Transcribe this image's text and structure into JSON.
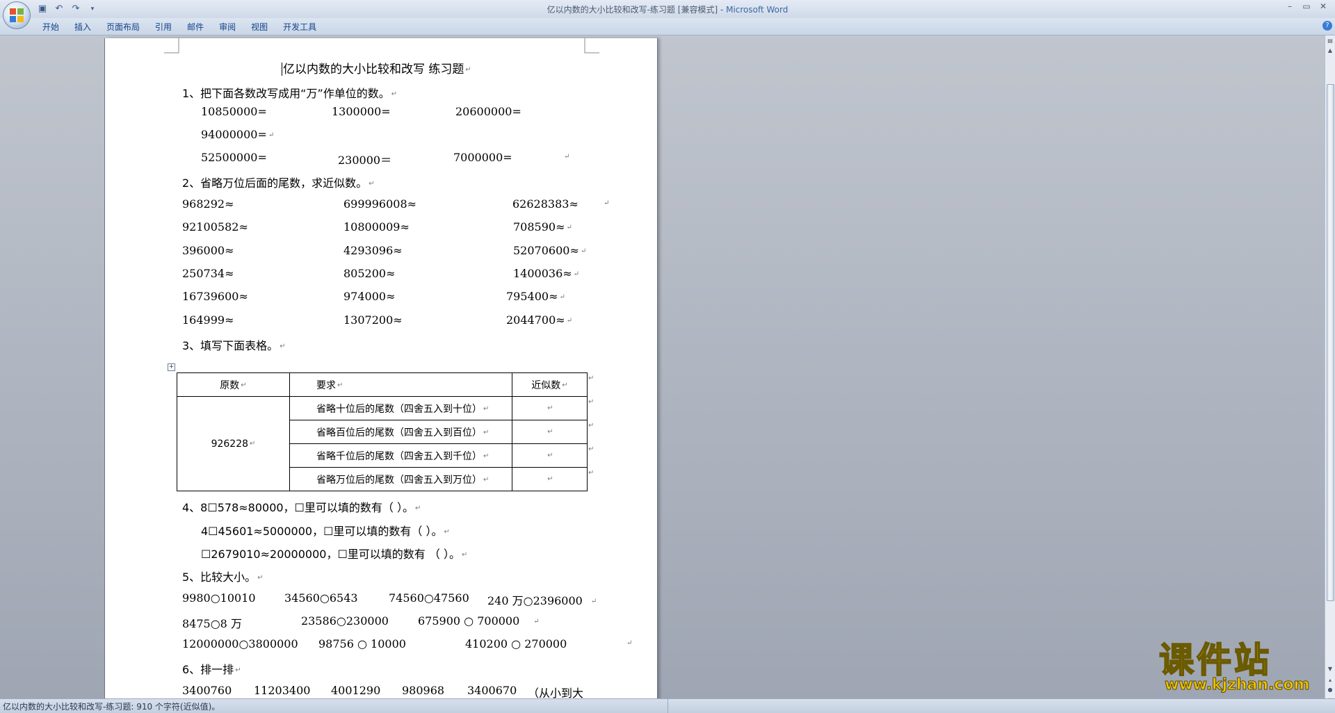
{
  "window": {
    "title": "亿以内数的大小比较和改写-练习题 [兼容模式] - ",
    "app_name": "Microsoft Word",
    "controls": [
      "–",
      "▭",
      "✕"
    ]
  },
  "quick_access": {
    "save_icon": "save-icon",
    "undo_icon": "undo-icon",
    "redo_icon": "redo-icon",
    "customize_icon": "customize-icon"
  },
  "ribbon": {
    "tabs": [
      "开始",
      "插入",
      "页面布局",
      "引用",
      "邮件",
      "审阅",
      "视图",
      "开发工具"
    ],
    "help": "?"
  },
  "document": {
    "title": "亿以内数的大小比较和改写 练习题",
    "mark": "↵",
    "q1": {
      "heading": "1、把下面各数改写成用“万”作单位的数。",
      "row1": [
        "10850000=",
        "1300000=",
        "20600000="
      ],
      "row2": [
        "94000000="
      ],
      "row3": [
        "52500000=",
        "230000＝",
        "7000000="
      ]
    },
    "q2": {
      "heading": "2、省略万位后面的尾数，求近似数。",
      "rows": [
        [
          "968292≈",
          "699996008≈",
          "62628383≈"
        ],
        [
          "92100582≈",
          "10800009≈",
          "708590≈"
        ],
        [
          "396000≈",
          "4293096≈",
          "52070600≈"
        ],
        [
          "250734≈",
          "805200≈",
          "1400036≈"
        ],
        [
          "16739600≈",
          "974000≈",
          "795400≈"
        ],
        [
          "164999≈",
          "1307200≈",
          "2044700≈"
        ]
      ]
    },
    "q3": {
      "heading": "3、填写下面表格。",
      "table": {
        "headers": [
          "原数",
          "要求",
          "近似数"
        ],
        "original": "926228",
        "requirements": [
          "省略十位后的尾数（四舍五入到十位）",
          "省略百位后的尾数（四舍五入到百位）",
          "省略千位后的尾数（四舍五入到千位）",
          "省略万位后的尾数（四舍五入到万位）"
        ]
      }
    },
    "q4": {
      "line1": "4、8☐578≈80000，☐里可以填的数有（                     ）。",
      "line2": "4☐45601≈5000000，☐里可以填的数有（                    ）。",
      "line3": "☐2679010≈20000000，☐里可以填的数有 （                  ）。"
    },
    "q5": {
      "heading": "5、比较大小。",
      "row1": [
        "9980○10010",
        "34560○6543",
        "74560○47560",
        "240 万○2396000"
      ],
      "row2": [
        "8475○8 万",
        "23586○230000",
        "675900 ○ 700000"
      ],
      "row3": [
        "12000000○3800000",
        "98756 ○ 10000",
        "410200 ○ 270000"
      ]
    },
    "q6": {
      "heading": "6、排一排",
      "row1": [
        "3400760",
        "11203400",
        "4001290",
        "980968",
        "3400670",
        "（从小到大"
      ]
    }
  },
  "status": {
    "text": "亿以内数的大小比较和改写-练习题: 910 个字符(近似值)。"
  },
  "watermark": {
    "brand": "课件站",
    "url": "www.kjzhan.com"
  },
  "colors": {
    "ribbon_text": "#15428b",
    "app_title": "#3a67a6",
    "watermark": "#f7d416"
  }
}
